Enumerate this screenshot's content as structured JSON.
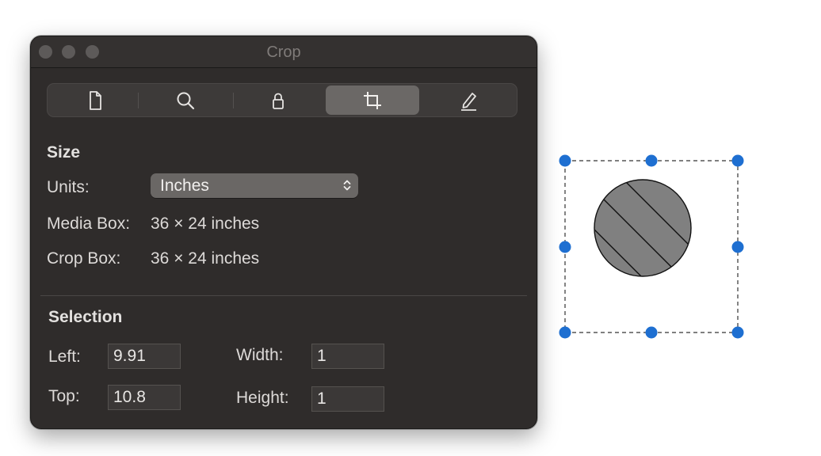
{
  "window": {
    "title": "Crop"
  },
  "toolbar": {
    "tabs": [
      {
        "icon": "document-icon",
        "active": false
      },
      {
        "icon": "magnifier-icon",
        "active": false
      },
      {
        "icon": "lock-icon",
        "active": false
      },
      {
        "icon": "crop-icon",
        "active": true
      },
      {
        "icon": "pencil-icon",
        "active": false
      }
    ]
  },
  "size": {
    "heading": "Size",
    "units_label": "Units:",
    "units_value": "Inches",
    "media_box_label": "Media Box:",
    "media_box_value": "36 × 24 inches",
    "crop_box_label": "Crop Box:",
    "crop_box_value": "36 × 24 inches"
  },
  "selection": {
    "heading": "Selection",
    "left_label": "Left:",
    "left_value": "9.91",
    "top_label": "Top:",
    "top_value": "10.8",
    "width_label": "Width:",
    "width_value": "1",
    "height_label": "Height:",
    "height_value": "1"
  },
  "colors": {
    "window_bg": "#2f2c2b",
    "active_segment": "#6b6866",
    "selection_handle": "#1e6fd1",
    "shape_fill": "#808080"
  }
}
